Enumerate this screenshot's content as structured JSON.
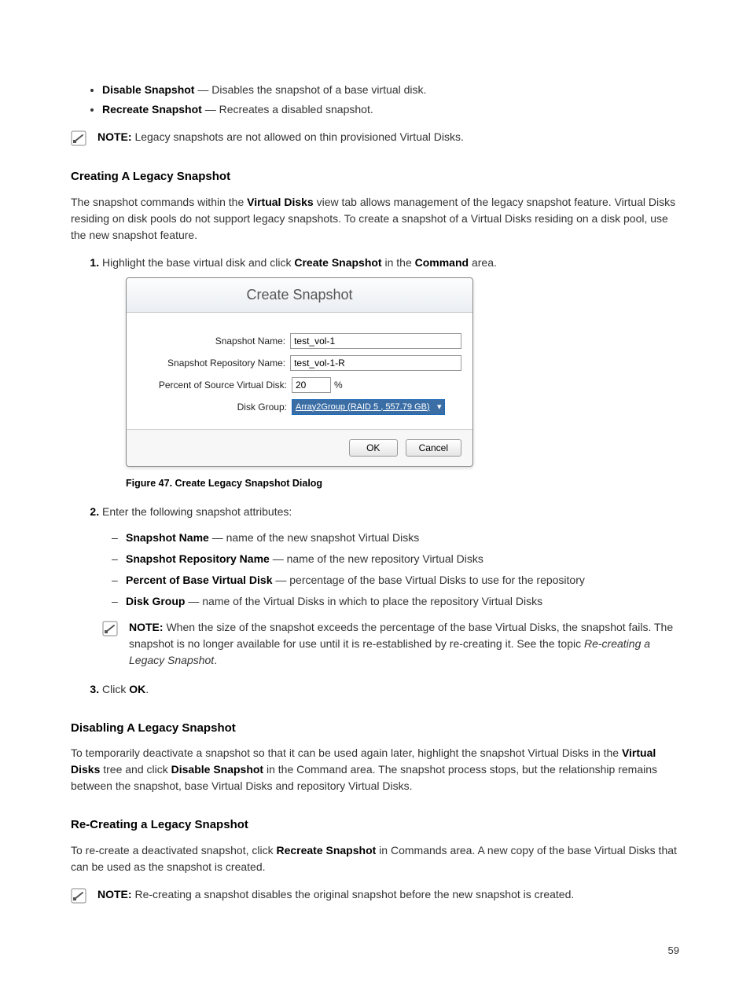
{
  "bullets": {
    "disable_snapshot_bold": "Disable Snapshot",
    "disable_snapshot_text": " — Disables the snapshot of a base virtual disk.",
    "recreate_snapshot_bold": "Recreate Snapshot",
    "recreate_snapshot_text": " — Recreates a disabled snapshot."
  },
  "note1": {
    "label": "NOTE:",
    "text": " Legacy snapshots are not allowed on thin provisioned Virtual Disks."
  },
  "sec_creating": {
    "heading": "Creating A Legacy Snapshot",
    "para_part1": "The snapshot commands within the ",
    "para_bold1": "Virtual Disks",
    "para_part2": " view tab allows management of the legacy snapshot feature. Virtual Disks residing on disk pools do not support legacy snapshots. To create a snapshot of a Virtual Disks residing on a disk pool, use the new snapshot feature."
  },
  "step1": {
    "part1": "Highlight the base virtual disk and click ",
    "bold1": "Create Snapshot",
    "part2": " in the ",
    "bold2": "Command",
    "part3": " area."
  },
  "dialog": {
    "title": "Create Snapshot",
    "snapshot_name_label": "Snapshot Name:",
    "snapshot_name_value": "test_vol-1",
    "repo_name_label": "Snapshot Repository Name:",
    "repo_name_value": "test_vol-1-R",
    "percent_label": "Percent of Source Virtual Disk:",
    "percent_value": "20",
    "percent_sign": "%",
    "disk_group_label": "Disk Group:",
    "disk_group_value": "Array2Group (RAID 5 , 557.79 GB)",
    "ok": "OK",
    "cancel": "Cancel"
  },
  "caption1": "Figure 47. Create Legacy Snapshot Dialog",
  "step2": {
    "lead": "Enter the following snapshot attributes:",
    "a_bold": "Snapshot Name",
    "a_text": " — name of the new snapshot Virtual Disks",
    "b_bold": "Snapshot Repository Name",
    "b_text": " — name of the new repository Virtual Disks",
    "c_bold": "Percent of Base Virtual Disk",
    "c_text": " — percentage of the base Virtual Disks to use for the repository",
    "d_bold": "Disk Group",
    "d_text": " — name of the Virtual Disks in which to place the repository Virtual Disks"
  },
  "note2": {
    "label": "NOTE:",
    "text_part1": " When the size of the snapshot exceeds the percentage of the base Virtual Disks, the snapshot fails. The snapshot is no longer available for use until it is re-established by re-creating it. See the topic ",
    "text_italic": "Re-creating a Legacy Snapshot",
    "text_part2": "."
  },
  "step3": {
    "part1": "Click ",
    "bold1": "OK",
    "part2": "."
  },
  "sec_disabling": {
    "heading": "Disabling A Legacy Snapshot",
    "para_part1": "To temporarily deactivate a snapshot so that it can be used again later, highlight the snapshot Virtual Disks in the ",
    "bold1": "Virtual Disks",
    "para_part2": " tree and click ",
    "bold2": "Disable Snapshot",
    "para_part3": " in the Command area. The snapshot process stops, but the relationship remains between the snapshot, base Virtual Disks and repository Virtual Disks."
  },
  "sec_recreating": {
    "heading": "Re-Creating a Legacy Snapshot",
    "para_part1": "To re-create a deactivated snapshot, click ",
    "bold1": "Recreate Snapshot",
    "para_part2": " in Commands area. A new copy of the base Virtual Disks that can be used as the snapshot is created."
  },
  "note3": {
    "label": "NOTE:",
    "text": " Re-creating a snapshot disables the original snapshot before the new snapshot is created."
  },
  "page_number": "59"
}
